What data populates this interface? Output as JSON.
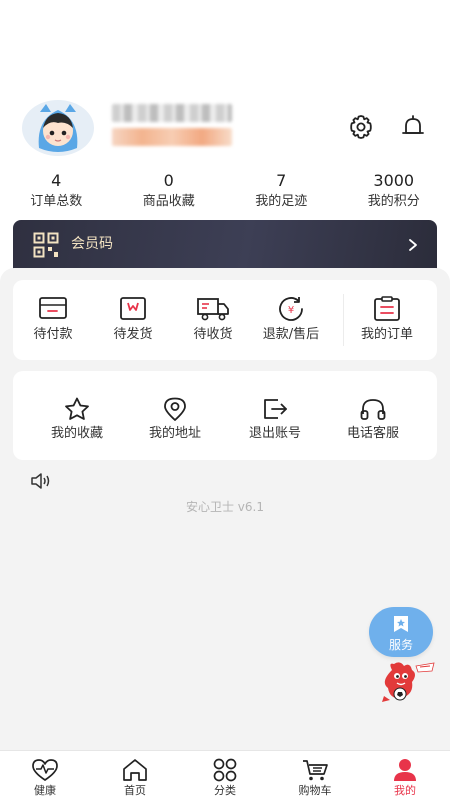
{
  "stats": [
    {
      "value": "4",
      "label": "订单总数"
    },
    {
      "value": "0",
      "label": "商品收藏"
    },
    {
      "value": "7",
      "label": "我的足迹"
    },
    {
      "value": "3000",
      "label": "我的积分"
    }
  ],
  "member": {
    "label": "会员码"
  },
  "orders": [
    {
      "label": "待付款",
      "icon": "wallet-icon"
    },
    {
      "label": "待发货",
      "icon": "package-icon"
    },
    {
      "label": "待收货",
      "icon": "truck-icon"
    },
    {
      "label": "退款/售后",
      "icon": "refund-icon"
    },
    {
      "label": "我的订单",
      "icon": "clipboard-icon"
    }
  ],
  "tools": [
    {
      "label": "我的收藏",
      "icon": "star-icon"
    },
    {
      "label": "我的地址",
      "icon": "location-icon"
    },
    {
      "label": "退出账号",
      "icon": "logout-icon"
    },
    {
      "label": "电话客服",
      "icon": "headset-icon"
    }
  ],
  "version": "安心卫士 v6.1",
  "service": {
    "label": "服务"
  },
  "tabs": [
    {
      "label": "健康",
      "icon": "heart-pulse-icon"
    },
    {
      "label": "首页",
      "icon": "home-icon"
    },
    {
      "label": "分类",
      "icon": "grid-icon"
    },
    {
      "label": "购物车",
      "icon": "cart-icon"
    },
    {
      "label": "我的",
      "icon": "user-icon",
      "active": true
    }
  ],
  "colors": {
    "accent": "#e8344a",
    "service": "#6fb0ec",
    "member_text": "#f3e3c2",
    "member_bg": "#2f3040"
  }
}
